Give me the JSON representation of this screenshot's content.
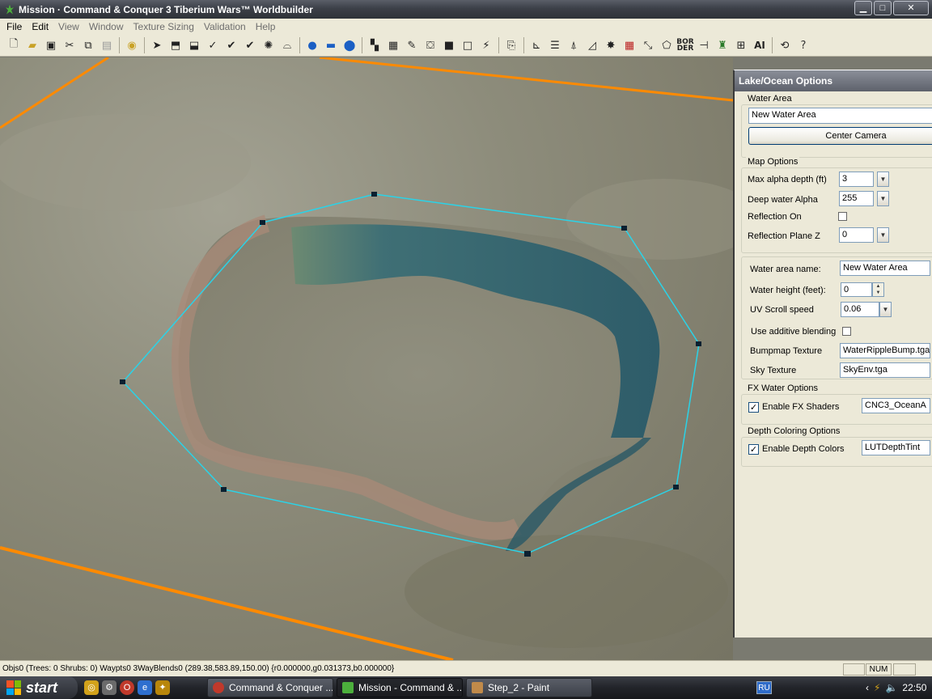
{
  "window": {
    "title": "Mission · Command & Conquer 3 Tiberium Wars™ Worldbuilder",
    "controls": {
      "minimize": "▁",
      "maximize": "□",
      "close": "✕"
    }
  },
  "menu": [
    "File",
    "Edit",
    "View",
    "Window",
    "Texture Sizing",
    "Validation",
    "Help"
  ],
  "toolbar": {
    "icons": [
      "new-file-icon",
      "open-folder-icon",
      "save-icon",
      "cut-icon",
      "copy-icon",
      "paste-icon",
      "brush-icon",
      "select-arrow-icon",
      "move-object-icon",
      "rotate-object-icon",
      "check-icon",
      "check-plus-icon",
      "check-multi-icon",
      "point-icon",
      "elevation-icon",
      "blue-blob-icon",
      "blue-rect-icon",
      "blue-circle-icon",
      "checker-icon",
      "checker-grid-icon",
      "eyedropper-icon",
      "fill-icon",
      "square-icon",
      "rect-outline-icon",
      "wand-icon",
      "clipboard-icon",
      "axis-icon",
      "lines-icon",
      "tree-icon",
      "ramp-icon",
      "star-icon",
      "grid-red-icon",
      "path-icon",
      "polygon-icon",
      "border-icon",
      "connector-icon",
      "team-icon",
      "grid-tool-icon",
      "ai-icon",
      "rewind-icon",
      "help-icon"
    ],
    "border_label": "BOR\nDER",
    "ai_label": "AI"
  },
  "panel": {
    "title": "Lake/Ocean Options",
    "water_area": {
      "label": "Water Area",
      "name_value": "New Water Area",
      "center_camera": "Center Camera"
    },
    "map_options": {
      "label": "Map Options",
      "max_alpha_label": "Max alpha depth (ft)",
      "max_alpha_value": "3",
      "deep_alpha_label": "Deep water Alpha",
      "deep_alpha_value": "255",
      "reflection_on_label": "Reflection On",
      "reflection_on_checked": false,
      "reflection_z_label": "Reflection Plane Z",
      "reflection_z_value": "0"
    },
    "water": {
      "name_label": "Water area name:",
      "name_value": "New Water Area",
      "height_label": "Water height (feet):",
      "height_value": "0",
      "uv_label": "UV Scroll speed",
      "uv_value": "0.06",
      "additive_label": "Use additive blending",
      "additive_checked": false,
      "bumpmap_label": "Bumpmap Texture",
      "bumpmap_value": "WaterRippleBump.tga",
      "sky_label": "Sky Texture",
      "sky_value": "SkyEnv.tga"
    },
    "fx": {
      "label": "FX Water Options",
      "enable_label": "Enable FX Shaders",
      "enable_checked": true,
      "shader_value": "CNC3_OceanA"
    },
    "depth": {
      "label": "Depth Coloring Options",
      "enable_label": "Enable Depth Colors",
      "enable_checked": true,
      "tint_value": "LUTDepthTint"
    }
  },
  "status": {
    "text": "Objs0 (Trees: 0 Shrubs: 0) Waypts0 3WayBlends0 (289.38,583.89,150.00) {r0.000000,g0.031373,b0.000000}",
    "num": "NUM"
  },
  "taskbar": {
    "start": "start",
    "tasks": [
      {
        "label": "Command & Conquer ...",
        "color": "#c0392b",
        "active": false
      },
      {
        "label": "Mission - Command & ...",
        "color": "#4caf3c",
        "active": true
      },
      {
        "label": "Step_2 - Paint",
        "color": "#c08a4a",
        "active": false
      }
    ],
    "lang": "RU",
    "time": "22:50"
  },
  "colors": {
    "water_outline": "#2ad3e8",
    "map_border": "#ff8a00",
    "water_fill": "#2f5d68"
  }
}
